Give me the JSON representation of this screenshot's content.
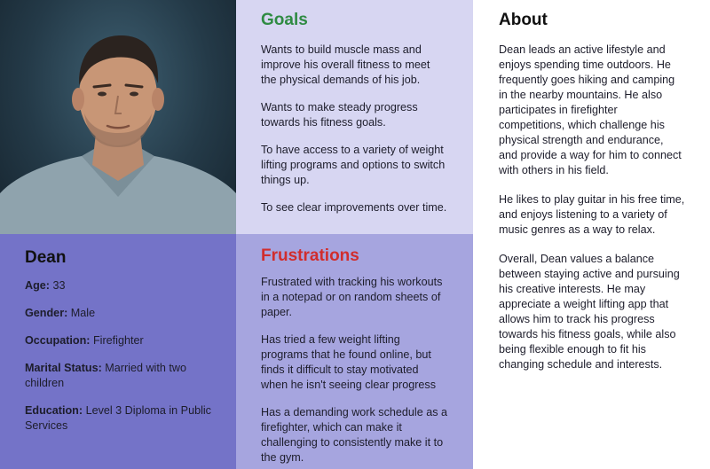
{
  "profile": {
    "name": "Dean",
    "fields": [
      {
        "label": "Age:",
        "value": " 33"
      },
      {
        "label": "Gender:",
        "value": " Male"
      },
      {
        "label": "Occupation:",
        "value": " Firefighter"
      },
      {
        "label": "Marital Status:",
        "value": " Married with two children"
      },
      {
        "label": "Education:",
        "value": " Level 3 Diploma in Public Services"
      }
    ]
  },
  "goals": {
    "title": "Goals",
    "items": [
      "Wants to build muscle mass and improve his overall fitness to meet the physical demands of his job.",
      "Wants to make steady progress towards his fitness goals.",
      "To have access to a variety of weight lifting programs and options to switch things up.",
      "To see clear improvements over time."
    ]
  },
  "frustrations": {
    "title": "Frustrations",
    "items": [
      "Frustrated with tracking his workouts in a notepad or on random sheets of paper.",
      "Has tried a few weight lifting programs that he found online, but finds it difficult to stay motivated when he isn't seeing clear progress",
      "Has a demanding work schedule as a firefighter, which can make it challenging to consistently make it to the gym."
    ]
  },
  "about": {
    "title": "About",
    "paragraphs": [
      "Dean leads an active lifestyle and enjoys spending time outdoors. He frequently goes hiking and camping in the nearby mountains. He also participates in firefighter competitions, which challenge his physical strength and endurance, and provide a way for him to connect with others in his field.",
      "He likes to play guitar in his free time, and enjoys listening to a variety of music genres as a way to relax.",
      "Overall, Dean values a balance between staying active and pursuing his creative interests. He may appreciate a weight lifting app that allows him to track his progress towards his fitness goals, while also being flexible enough to fit his changing schedule and interests."
    ]
  },
  "colors": {
    "goals_title": "#2f8b43",
    "frustrations_title": "#d12d2d",
    "profile_bg": "#7473c8",
    "goals_bg": "#d7d6f2",
    "frustrations_bg": "#a6a5df"
  }
}
